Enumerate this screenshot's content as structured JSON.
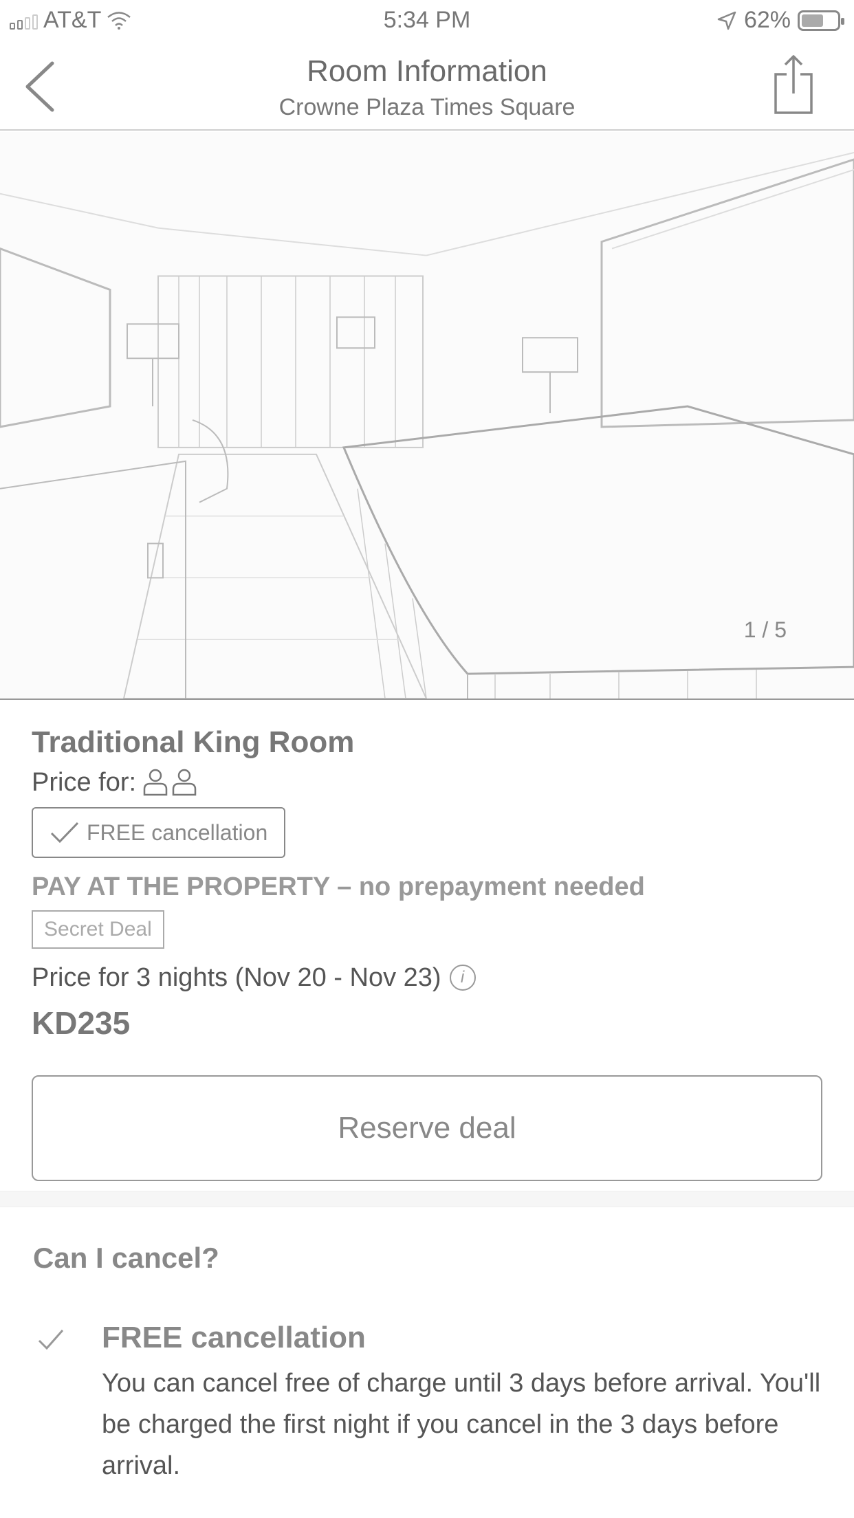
{
  "status_bar": {
    "carrier": "AT&T",
    "time": "5:34 PM",
    "battery_percent": "62%",
    "battery_level": 0.62,
    "icons": [
      "signal-icon",
      "wifi-icon",
      "location-arrow-icon",
      "battery-icon"
    ]
  },
  "nav": {
    "title": "Room Information",
    "subtitle": "Crowne Plaza Times Square",
    "back_icon": "chevron-left-icon",
    "share_icon": "share-icon"
  },
  "photo": {
    "counter": "1 / 5"
  },
  "room": {
    "name": "Traditional King Room",
    "price_for_label": "Price for:",
    "guests": 2,
    "free_cancellation_badge": "FREE cancellation",
    "pay_line": "PAY AT THE PROPERTY – no prepayment needed",
    "secret_deal": "Secret Deal",
    "nights_label": "Price for 3 nights (Nov 20 - Nov 23)",
    "info_glyph": "i",
    "price": "KD235",
    "reserve_label": "Reserve deal"
  },
  "cancel": {
    "title": "Can I cancel?",
    "item_title": "FREE cancellation",
    "item_text": "You can cancel free of charge until 3 days before arrival. You'll be charged the first night if you cancel in the 3 days before arrival."
  }
}
